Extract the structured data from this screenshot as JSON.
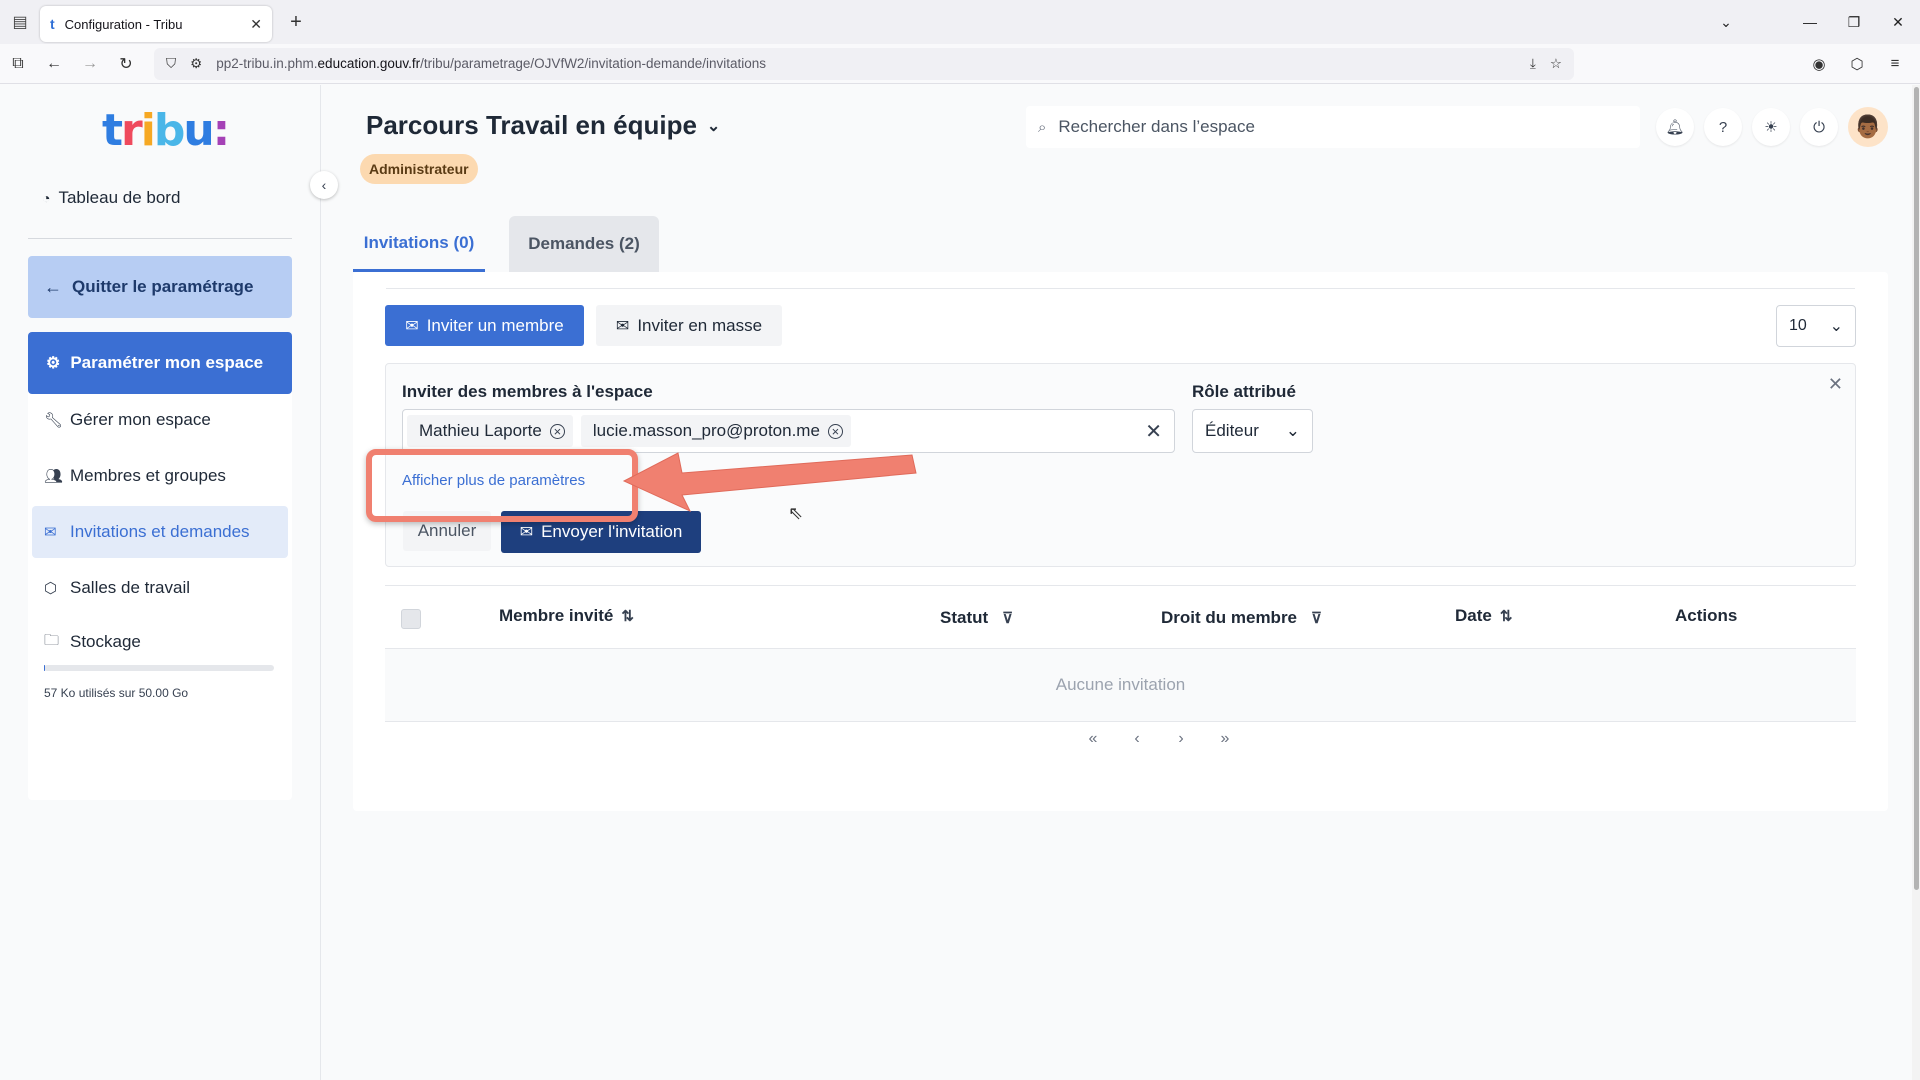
{
  "browser": {
    "tab_title": "Configuration - Tribu",
    "url_prefix": "pp2-tribu.in.phm.",
    "url_domain": "education.gouv.fr",
    "url_path": "/tribu/parametrage/OJVfW2/invitation-demande/invitations"
  },
  "sidebar": {
    "logo_text": "tribu:",
    "dashboard": "Tableau de bord",
    "quit_label": "Quitter le paramétrage",
    "param_label": "Paramétrer mon espace",
    "items": [
      {
        "label": "Gérer mon espace",
        "icon": "wrench-icon"
      },
      {
        "label": "Membres et groupes",
        "icon": "users-icon"
      },
      {
        "label": "Invitations et demandes",
        "icon": "mail-icon"
      },
      {
        "label": "Salles de travail",
        "icon": "box-icon"
      },
      {
        "label": "Stockage",
        "icon": "folder-icon"
      }
    ],
    "storage_text": "57 Ko utilisés sur 50.00 Go",
    "storage_fraction": 0.001
  },
  "header": {
    "space_title": "Parcours Travail en équipe",
    "role_badge": "Administrateur",
    "search_placeholder": "Rechercher dans l’espace"
  },
  "tabs": [
    {
      "label": "Invitations (0)",
      "active": true
    },
    {
      "label": "Demandes (2)",
      "active": false
    }
  ],
  "toolbar": {
    "invite_member": "Inviter un membre",
    "invite_mass": "Inviter en masse",
    "per_page": "10"
  },
  "invite_form": {
    "members_label": "Inviter des membres à l'espace",
    "chips": [
      "Mathieu Laporte",
      "lucie.masson_pro@proton.me"
    ],
    "role_label": "Rôle attribué",
    "role_value": "Éditeur",
    "more_params": "Afficher plus de paramètres",
    "cancel": "Annuler",
    "send": "Envoyer l'invitation"
  },
  "table": {
    "columns": [
      "Membre invité",
      "Statut",
      "Droit du membre",
      "Date",
      "Actions"
    ],
    "empty_text": "Aucune invitation",
    "pager": [
      "«",
      "‹",
      "›",
      "»"
    ]
  },
  "colors": {
    "accent": "#3b6fd3",
    "annotation": "#f08070"
  }
}
